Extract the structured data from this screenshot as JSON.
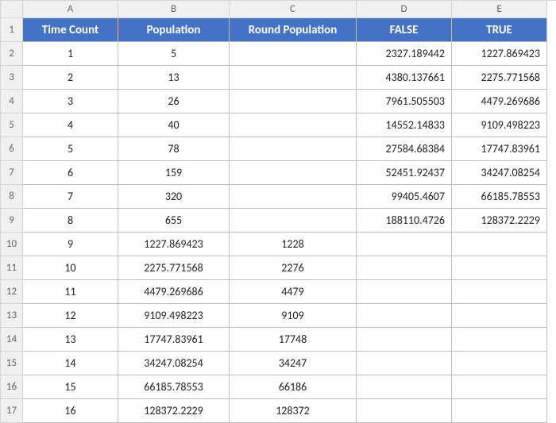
{
  "columns": [
    "A",
    "B",
    "C",
    "D",
    "E"
  ],
  "row_numbers": [
    "1",
    "2",
    "3",
    "4",
    "5",
    "6",
    "7",
    "8",
    "9",
    "10",
    "11",
    "12",
    "13",
    "14",
    "15",
    "16",
    "17"
  ],
  "headers": {
    "a": "Time Count",
    "b": "Population",
    "c": "Round Population",
    "d": "FALSE",
    "e": "TRUE"
  },
  "rows": [
    {
      "a": "1",
      "b": "5",
      "c": "",
      "d": "2327.189442",
      "e": "1227.869423"
    },
    {
      "a": "2",
      "b": "13",
      "c": "",
      "d": "4380.137661",
      "e": "2275.771568"
    },
    {
      "a": "3",
      "b": "26",
      "c": "",
      "d": "7961.505503",
      "e": "4479.269686"
    },
    {
      "a": "4",
      "b": "40",
      "c": "",
      "d": "14552.14833",
      "e": "9109.498223"
    },
    {
      "a": "5",
      "b": "78",
      "c": "",
      "d": "27584.68384",
      "e": "17747.83961"
    },
    {
      "a": "6",
      "b": "159",
      "c": "",
      "d": "52451.92437",
      "e": "34247.08254"
    },
    {
      "a": "7",
      "b": "320",
      "c": "",
      "d": "99405.4607",
      "e": "66185.78553"
    },
    {
      "a": "8",
      "b": "655",
      "c": "",
      "d": "188110.4726",
      "e": "128372.2229"
    },
    {
      "a": "9",
      "b": "1227.869423",
      "c": "1228",
      "d": "",
      "e": ""
    },
    {
      "a": "10",
      "b": "2275.771568",
      "c": "2276",
      "d": "",
      "e": ""
    },
    {
      "a": "11",
      "b": "4479.269686",
      "c": "4479",
      "d": "",
      "e": ""
    },
    {
      "a": "12",
      "b": "9109.498223",
      "c": "9109",
      "d": "",
      "e": ""
    },
    {
      "a": "13",
      "b": "17747.83961",
      "c": "17748",
      "d": "",
      "e": ""
    },
    {
      "a": "14",
      "b": "34247.08254",
      "c": "34247",
      "d": "",
      "e": ""
    },
    {
      "a": "15",
      "b": "66185.78553",
      "c": "66186",
      "d": "",
      "e": ""
    },
    {
      "a": "16",
      "b": "128372.2229",
      "c": "128372",
      "d": "",
      "e": ""
    }
  ],
  "chart_data": {
    "type": "table",
    "title": "",
    "columns": [
      "Time Count",
      "Population",
      "Round Population",
      "FALSE",
      "TRUE"
    ],
    "data": [
      [
        1,
        5,
        null,
        2327.189442,
        1227.869423
      ],
      [
        2,
        13,
        null,
        4380.137661,
        2275.771568
      ],
      [
        3,
        26,
        null,
        7961.505503,
        4479.269686
      ],
      [
        4,
        40,
        null,
        14552.14833,
        9109.498223
      ],
      [
        5,
        78,
        null,
        27584.68384,
        17747.83961
      ],
      [
        6,
        159,
        null,
        52451.92437,
        34247.08254
      ],
      [
        7,
        320,
        null,
        99405.4607,
        66185.78553
      ],
      [
        8,
        655,
        null,
        188110.4726,
        128372.2229
      ],
      [
        9,
        1227.869423,
        1228,
        null,
        null
      ],
      [
        10,
        2275.771568,
        2276,
        null,
        null
      ],
      [
        11,
        4479.269686,
        4479,
        null,
        null
      ],
      [
        12,
        9109.498223,
        9109,
        null,
        null
      ],
      [
        13,
        17747.83961,
        17748,
        null,
        null
      ],
      [
        14,
        34247.08254,
        34247,
        null,
        null
      ],
      [
        15,
        66185.78553,
        66186,
        null,
        null
      ],
      [
        16,
        128372.2229,
        128372,
        null,
        null
      ]
    ]
  }
}
